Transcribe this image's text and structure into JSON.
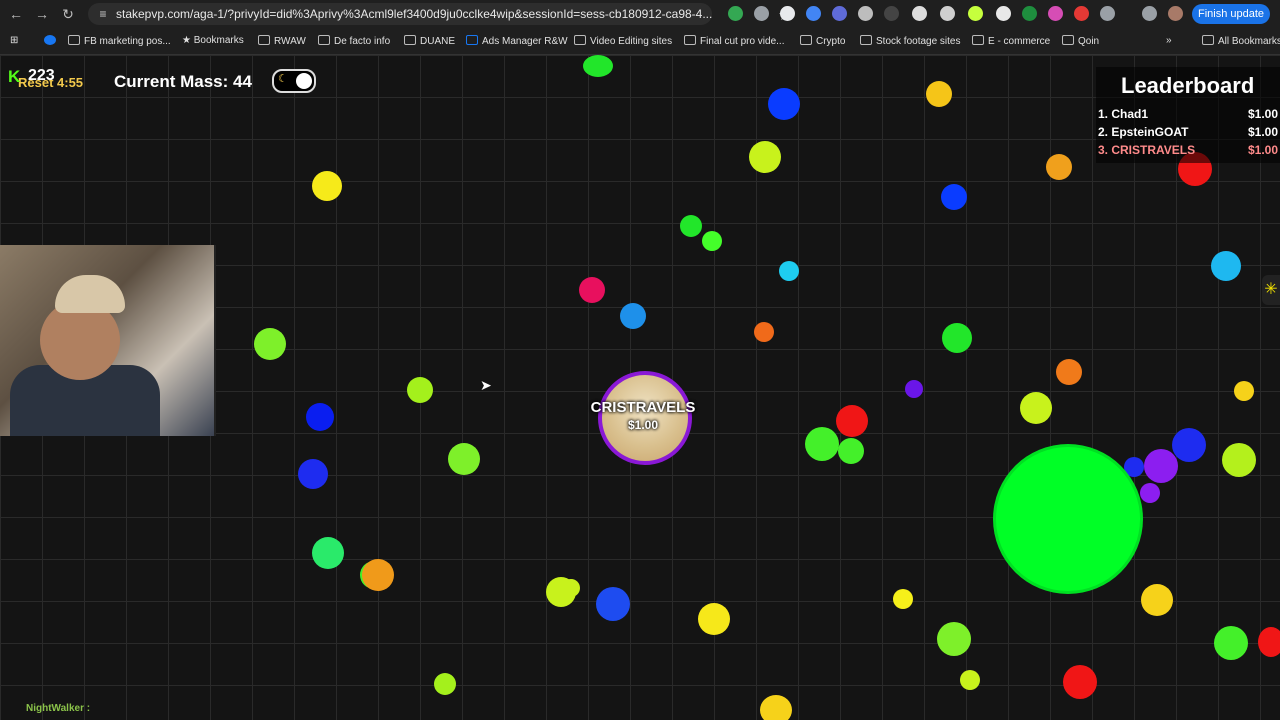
{
  "browser": {
    "url": "stakepvp.com/aga-1/?privyId=did%3Aprivy%3Acml9lef3400d9ju0cclke4wip&sessionId=sess-cb180912-ca98-4...",
    "finish_update": "Finish update",
    "bookmarks": [
      "FB marketing pos...",
      "Bookmarks",
      "RWAW",
      "De facto info",
      "DUANE",
      "Ads Manager R&W",
      "Video Editing sites",
      "Final cut pro vide...",
      "Crypto",
      "Stock footage sites",
      "E - commerce",
      "Qoin"
    ],
    "all_bookmarks": "All Bookmarks"
  },
  "hud": {
    "kick_logo": "K",
    "viewer_count": "223",
    "reset_timer": "Reset 4:55",
    "mass_label": "Current Mass: 44",
    "moon_icon": "☾"
  },
  "leaderboard": {
    "title": "Leaderboard",
    "rows": [
      {
        "name": "1. Chad1",
        "amount": "$1.00"
      },
      {
        "name": "2. EpsteinGOAT",
        "amount": "$1.00"
      },
      {
        "name": "3. CRISTRAVELS",
        "amount": "$1.00"
      }
    ]
  },
  "player": {
    "name": "CRISTRAVELS",
    "amount": "$1.00"
  },
  "chat": {
    "user": "NightWalker :"
  },
  "colors": {
    "accent": "#53fc18",
    "player_border": "#8a18d6",
    "big_blob": "#00ff26"
  }
}
